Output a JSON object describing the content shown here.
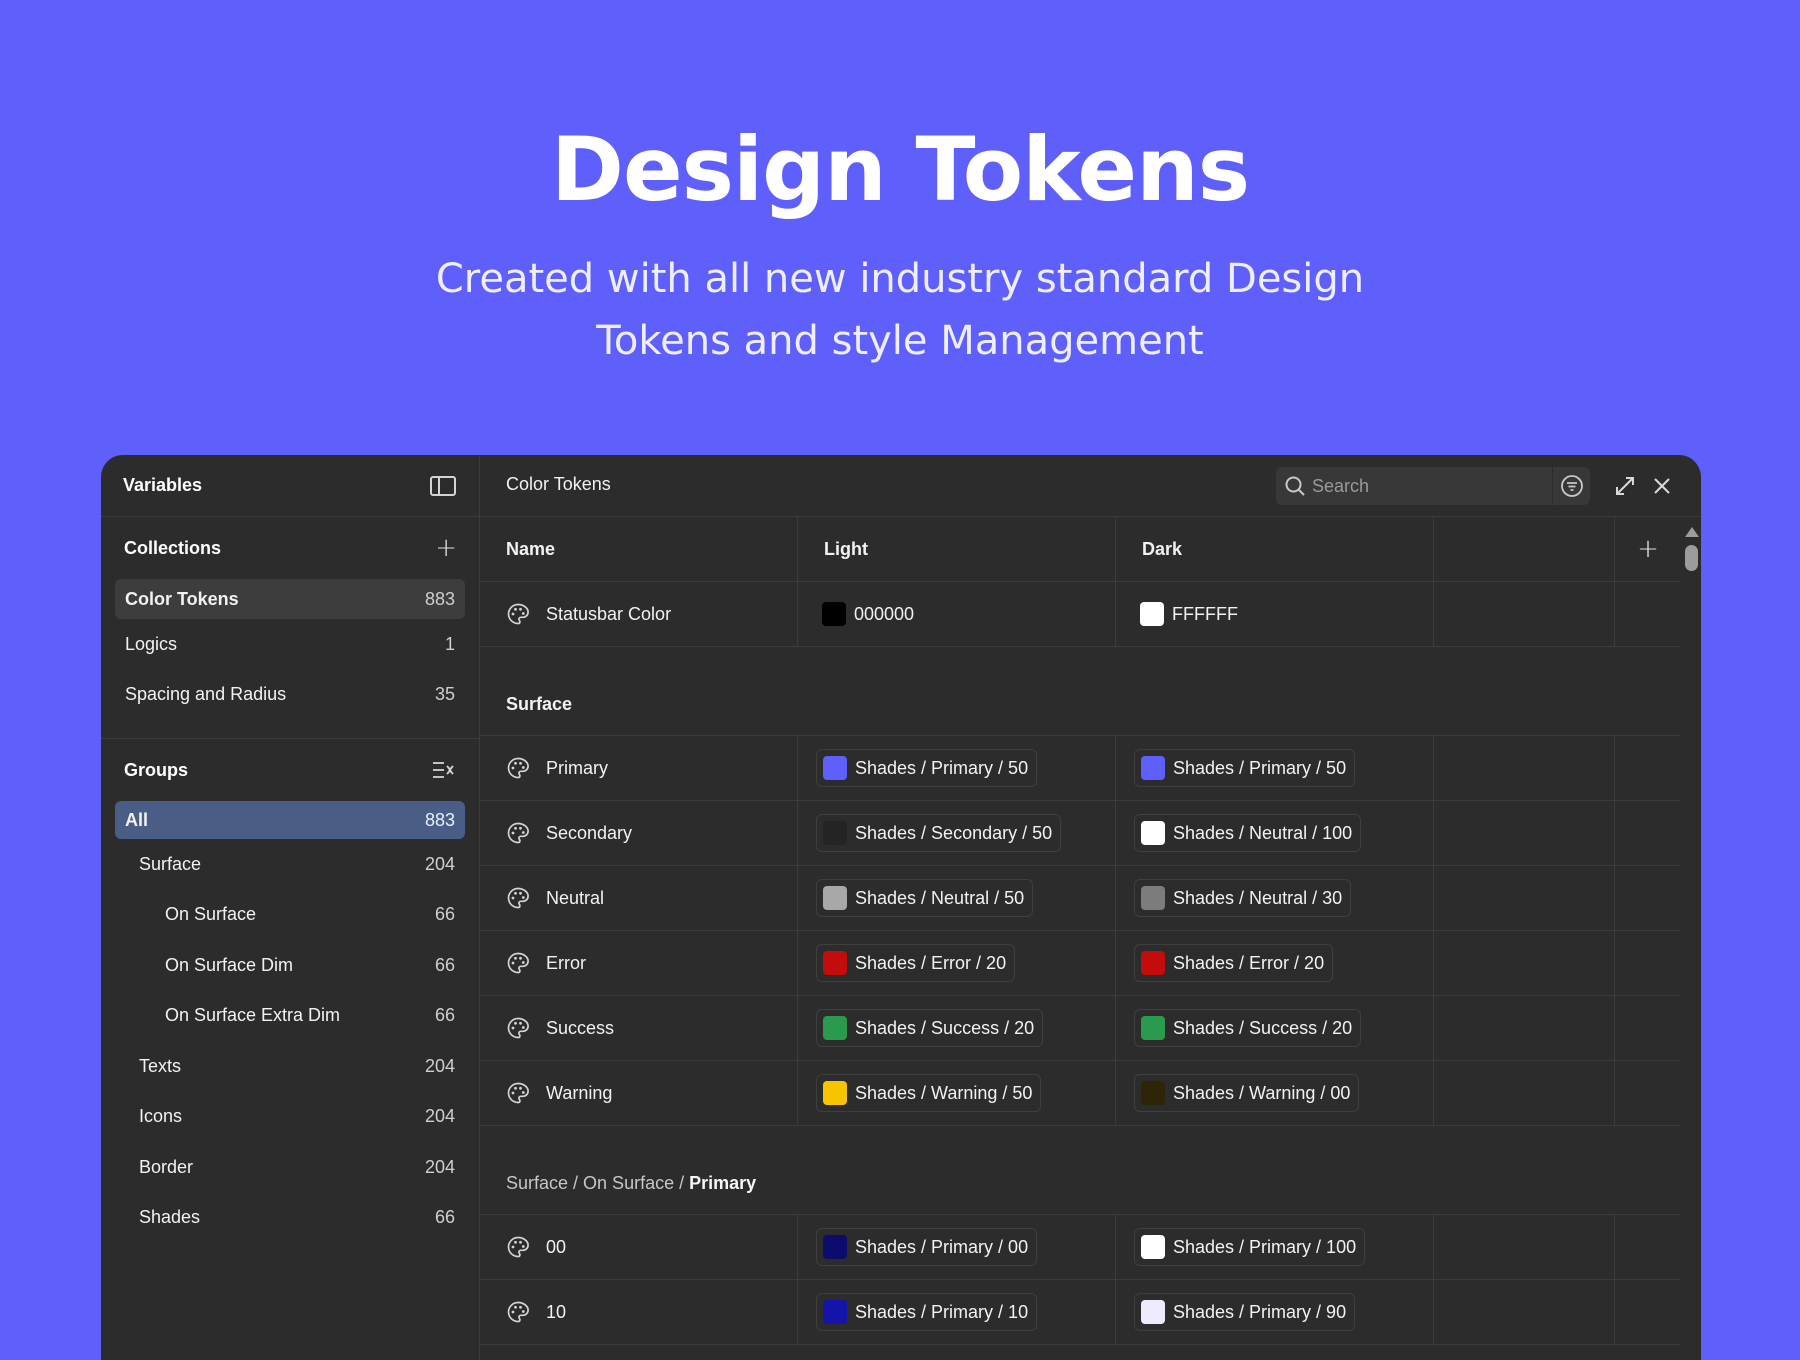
{
  "hero": {
    "title": "Design Tokens",
    "subtitle_line1": "Created with all new industry standard Design",
    "subtitle_line2": "Tokens and style Management"
  },
  "sidebar": {
    "title": "Variables",
    "collections_title": "Collections",
    "collections": [
      {
        "label": "Color Tokens",
        "count": "883"
      },
      {
        "label": "Logics",
        "count": "1"
      },
      {
        "label": "Spacing and Radius",
        "count": "35"
      }
    ],
    "groups_title": "Groups",
    "groups": [
      {
        "label": "All",
        "count": "883"
      },
      {
        "label": "Surface",
        "count": "204"
      },
      {
        "label": "On Surface",
        "count": "66"
      },
      {
        "label": "On Surface Dim",
        "count": "66"
      },
      {
        "label": "On Surface Extra Dim",
        "count": "66"
      },
      {
        "label": "Texts",
        "count": "204"
      },
      {
        "label": "Icons",
        "count": "204"
      },
      {
        "label": "Border",
        "count": "204"
      },
      {
        "label": "Shades",
        "count": "66"
      }
    ]
  },
  "main": {
    "title": "Color Tokens",
    "search_placeholder": "Search",
    "columns": [
      "Name",
      "Light",
      "Dark"
    ],
    "statusbar": {
      "name": "Statusbar Color",
      "light": "000000",
      "light_color": "#000000",
      "dark": "FFFFFF",
      "dark_color": "#FFFFFF"
    },
    "surface_group": "Surface",
    "surface_rows": [
      {
        "name": "Primary",
        "light": "Shades / Primary / 50",
        "light_color": "#5f5ffb",
        "dark": "Shades / Primary / 50",
        "dark_color": "#5f5ffb"
      },
      {
        "name": "Secondary",
        "light": "Shades / Secondary / 50",
        "light_color": "#242424",
        "dark": "Shades / Neutral / 100",
        "dark_color": "#ffffff"
      },
      {
        "name": "Neutral",
        "light": "Shades / Neutral / 50",
        "light_color": "#a8a8a8",
        "dark": "Shades / Neutral / 30",
        "dark_color": "#7c7c7c"
      },
      {
        "name": "Error",
        "light": "Shades / Error / 20",
        "light_color": "#c40c0c",
        "dark": "Shades / Error / 20",
        "dark_color": "#c40c0c"
      },
      {
        "name": "Success",
        "light": "Shades / Success / 20",
        "light_color": "#2a9a4e",
        "dark": "Shades / Success / 20",
        "dark_color": "#2a9a4e"
      },
      {
        "name": "Warning",
        "light": "Shades / Warning / 50",
        "light_color": "#f8c400",
        "dark": "Shades / Warning / 00",
        "dark_color": "#2e2508"
      }
    ],
    "crumb": {
      "part1": "Surface / ",
      "part2": " On Surface / ",
      "part3": "Primary"
    },
    "primary_rows": [
      {
        "name": "00",
        "light": "Shades / Primary / 00",
        "light_color": "#0c0c6c",
        "dark": "Shades / Primary / 100",
        "dark_color": "#ffffff"
      },
      {
        "name": "10",
        "light": "Shades / Primary / 10",
        "light_color": "#1414aa",
        "dark": "Shades / Primary / 90",
        "dark_color": "#ececfe"
      }
    ]
  }
}
